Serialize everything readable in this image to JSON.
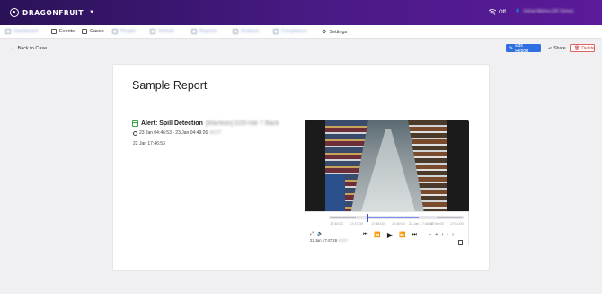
{
  "app": {
    "brand": "DRAGONFRUIT",
    "wifi_status": "Off",
    "user_label": "Vishal Mishra (DF Demo)"
  },
  "nav": {
    "items": [
      {
        "label": "Dashboard",
        "icon": "grid-icon"
      },
      {
        "label": "Events",
        "icon": "file-icon"
      },
      {
        "label": "Cases",
        "icon": "folder-icon"
      },
      {
        "label": "People",
        "icon": "people-icon"
      },
      {
        "label": "Vehicle",
        "icon": "car-icon"
      },
      {
        "label": "Reports",
        "icon": "report-icon"
      },
      {
        "label": "Analysis",
        "icon": "chart-icon"
      },
      {
        "label": "Compliance",
        "icon": "shield-icon"
      },
      {
        "label": "Settings",
        "icon": "gear-icon"
      }
    ]
  },
  "actions": {
    "back_label": "Back to Case",
    "edit_label": "Edit Report",
    "share_label": "Share",
    "delete_label": "Delete"
  },
  "report": {
    "title": "Sample Report",
    "alert_title": "Alert: Spill Detection",
    "alert_location": "[Maclean] D25-Isle 7 Back",
    "time_range": "23 Jan 04:46:53 - 23 Jan 04:49:26",
    "time_zone": "AEDT",
    "date": "22 Jan 17:46:53"
  },
  "player": {
    "ticks": [
      "17:46:00",
      "17:47:00",
      "17:48:00",
      "17:49:00",
      "22 Jan 17:46:00",
      "17:50:00",
      "17:51:00"
    ],
    "current_time": "22 Jan 17:47:26",
    "current_zone": "AEDT",
    "colors": {
      "recorded": "#7a8ff0",
      "marker": "#4050c0"
    }
  },
  "colors": {
    "topbar": "#3a1672",
    "accent": "#2f6fe0",
    "danger": "#d23c3c",
    "alert_icon": "#3fa34d"
  }
}
